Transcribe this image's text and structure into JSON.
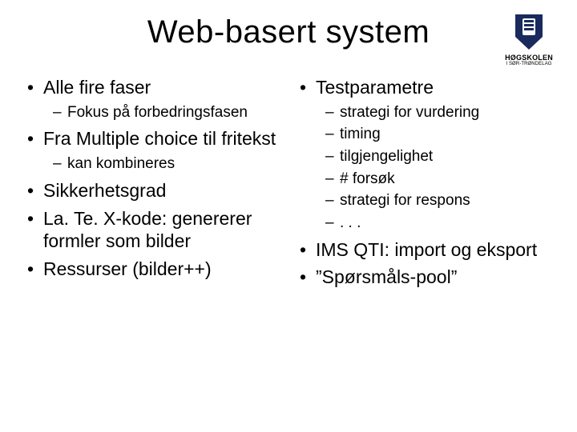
{
  "title": "Web-basert system",
  "logo": {
    "line1": "HØGSKOLEN",
    "line2": "I SØR-TRØNDELAG"
  },
  "left": {
    "items": [
      {
        "text": "Alle fire faser",
        "sub": [
          {
            "text": "Fokus på forbedringsfasen"
          }
        ]
      },
      {
        "text": "Fra Multiple choice til fritekst",
        "sub": [
          {
            "text": "kan kombineres"
          }
        ]
      },
      {
        "text": "Sikkerhetsgrad"
      },
      {
        "text": "La. Te. X-kode: genererer formler som bilder"
      },
      {
        "text": "Ressurser (bilder++)"
      }
    ]
  },
  "right": {
    "items": [
      {
        "text": "Testparametre",
        "sub": [
          {
            "text": "strategi for vurdering"
          },
          {
            "text": "timing"
          },
          {
            "text": "tilgjengelighet"
          },
          {
            "text": "# forsøk"
          },
          {
            "text": "strategi for respons"
          },
          {
            "text": ". . ."
          }
        ]
      },
      {
        "text": "IMS QTI: import og eksport"
      },
      {
        "text": "”Spørsmåls-pool”"
      }
    ]
  }
}
